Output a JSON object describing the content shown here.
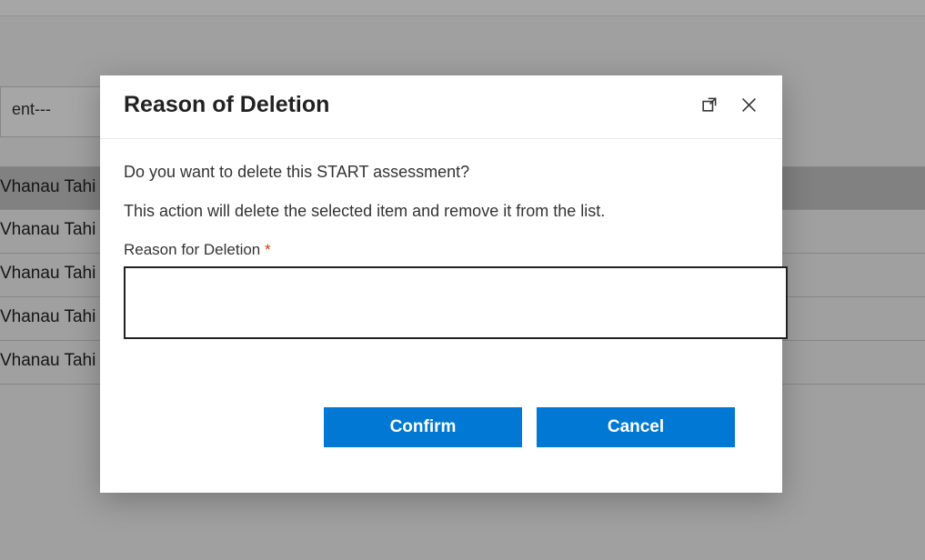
{
  "background": {
    "field_text": "ent---",
    "list_items": [
      "Vhanau Tahi",
      "Vhanau Tahi",
      "Vhanau Tahi",
      "Vhanau Tahi",
      "Vhanau Tahi"
    ]
  },
  "modal": {
    "title": "Reason of Deletion",
    "prompt": "Do you want to delete this START assessment?",
    "description": "This action will delete the selected item and remove it from the list.",
    "field_label": "Reason for Deletion",
    "required_marker": "*",
    "reason_value": "",
    "buttons": {
      "confirm": "Confirm",
      "cancel": "Cancel"
    }
  }
}
